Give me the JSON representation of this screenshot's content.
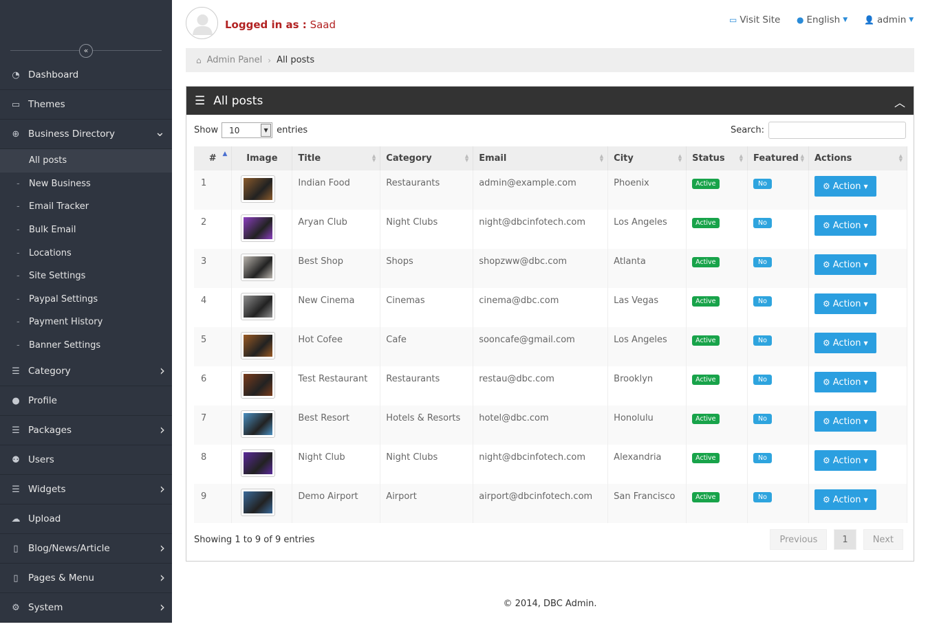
{
  "sidebar": {
    "collapse_icon": "double-chevron-left-icon",
    "items": [
      {
        "label": "Dashboard",
        "icon": "dashboard-icon"
      },
      {
        "label": "Themes",
        "icon": "monitor-icon"
      },
      {
        "label": "Business Directory",
        "icon": "plus-circle-icon"
      }
    ],
    "sub_items": [
      {
        "label": "All posts"
      },
      {
        "label": "New Business"
      },
      {
        "label": "Email Tracker"
      },
      {
        "label": "Bulk Email"
      },
      {
        "label": "Locations"
      },
      {
        "label": "Site Settings"
      },
      {
        "label": "Paypal Settings"
      },
      {
        "label": "Payment History"
      },
      {
        "label": "Banner Settings"
      }
    ],
    "items2": [
      {
        "label": "Category",
        "icon": "list-icon"
      },
      {
        "label": "Profile",
        "icon": "user-icon"
      },
      {
        "label": "Packages",
        "icon": "list-icon"
      },
      {
        "label": "Users",
        "icon": "users-icon"
      },
      {
        "label": "Widgets",
        "icon": "list-icon"
      },
      {
        "label": "Upload",
        "icon": "cloud-upload-icon"
      },
      {
        "label": "Blog/News/Article",
        "icon": "file-icon"
      },
      {
        "label": "Pages & Menu",
        "icon": "file-icon"
      },
      {
        "label": "System",
        "icon": "gear-icon"
      }
    ]
  },
  "header": {
    "logged_label": "Logged in as :",
    "user_name": "Saad",
    "visit_site": "Visit Site",
    "language": "English",
    "account": "admin"
  },
  "breadcrumb": {
    "root": "Admin Panel",
    "current": "All posts"
  },
  "panel": {
    "title": "All posts",
    "show_label": "Show",
    "entries_label": "entries",
    "page_size": "10",
    "search_label": "Search:",
    "search_value": "",
    "columns": [
      "#",
      "Image",
      "Title",
      "Category",
      "Email",
      "City",
      "Status",
      "Featured",
      "Actions"
    ],
    "rows": [
      {
        "n": "1",
        "title": "Indian Food",
        "category": "Restaurants",
        "email": "admin@example.com",
        "city": "Phoenix",
        "status": "Active",
        "featured": "No",
        "action": "Action",
        "img": "#8a5a2b"
      },
      {
        "n": "2",
        "title": "Aryan Club",
        "category": "Night Clubs",
        "email": "night@dbcinfotech.com",
        "city": "Los Angeles",
        "status": "Active",
        "featured": "No",
        "action": "Action",
        "img": "#8b3fbf"
      },
      {
        "n": "3",
        "title": "Best Shop",
        "category": "Shops",
        "email": "shopzww@dbc.com",
        "city": "Atlanta",
        "status": "Active",
        "featured": "No",
        "action": "Action",
        "img": "#b9b4ad"
      },
      {
        "n": "4",
        "title": "New Cinema",
        "category": "Cinemas",
        "email": "cinema@dbc.com",
        "city": "Las Vegas",
        "status": "Active",
        "featured": "No",
        "action": "Action",
        "img": "#8e8e8e"
      },
      {
        "n": "5",
        "title": "Hot Cofee",
        "category": "Cafe",
        "email": "sooncafe@gmail.com",
        "city": "Los Angeles",
        "status": "Active",
        "featured": "No",
        "action": "Action",
        "img": "#9a5a24"
      },
      {
        "n": "6",
        "title": "Test Restaurant",
        "category": "Restaurants",
        "email": "restau@dbc.com",
        "city": "Brooklyn",
        "status": "Active",
        "featured": "No",
        "action": "Action",
        "img": "#7a3c1c"
      },
      {
        "n": "7",
        "title": "Best Resort",
        "category": "Hotels & Resorts",
        "email": "hotel@dbc.com",
        "city": "Honolulu",
        "status": "Active",
        "featured": "No",
        "action": "Action",
        "img": "#4a8fc0"
      },
      {
        "n": "8",
        "title": "Night Club",
        "category": "Night Clubs",
        "email": "night@dbcinfotech.com",
        "city": "Alexandria",
        "status": "Active",
        "featured": "No",
        "action": "Action",
        "img": "#5a2a9a"
      },
      {
        "n": "9",
        "title": "Demo Airport",
        "category": "Airport",
        "email": "airport@dbcinfotech.com",
        "city": "San Francisco",
        "status": "Active",
        "featured": "No",
        "action": "Action",
        "img": "#3a6a9a"
      }
    ],
    "showing": "Showing 1 to 9 of 9 entries",
    "pager": {
      "prev": "Previous",
      "current": "1",
      "next": "Next"
    }
  },
  "footer": "© 2014, DBC Admin.",
  "colors": {
    "sidebar": "#2f3540",
    "panel_header": "#333333",
    "accent": "#2b9fe0",
    "active_badge": "#18a34a",
    "login_text": "#b22222"
  }
}
